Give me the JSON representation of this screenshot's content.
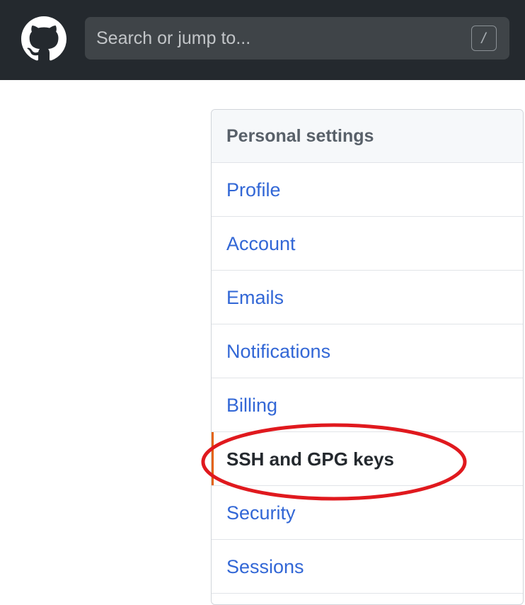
{
  "header": {
    "logo_icon": "github-octocat-icon",
    "search": {
      "placeholder": "Search or jump to...",
      "shortcut_key": "/"
    }
  },
  "settings_menu": {
    "title": "Personal settings",
    "items": [
      {
        "label": "Profile"
      },
      {
        "label": "Account"
      },
      {
        "label": "Emails"
      },
      {
        "label": "Notifications"
      },
      {
        "label": "Billing"
      },
      {
        "label": "SSH and GPG keys",
        "selected": true
      },
      {
        "label": "Security"
      },
      {
        "label": "Sessions"
      }
    ]
  },
  "colors": {
    "topbar": "#24292e",
    "link": "#3267d6",
    "selected_indicator": "#e36209",
    "annotation_circle": "#e0191e"
  }
}
